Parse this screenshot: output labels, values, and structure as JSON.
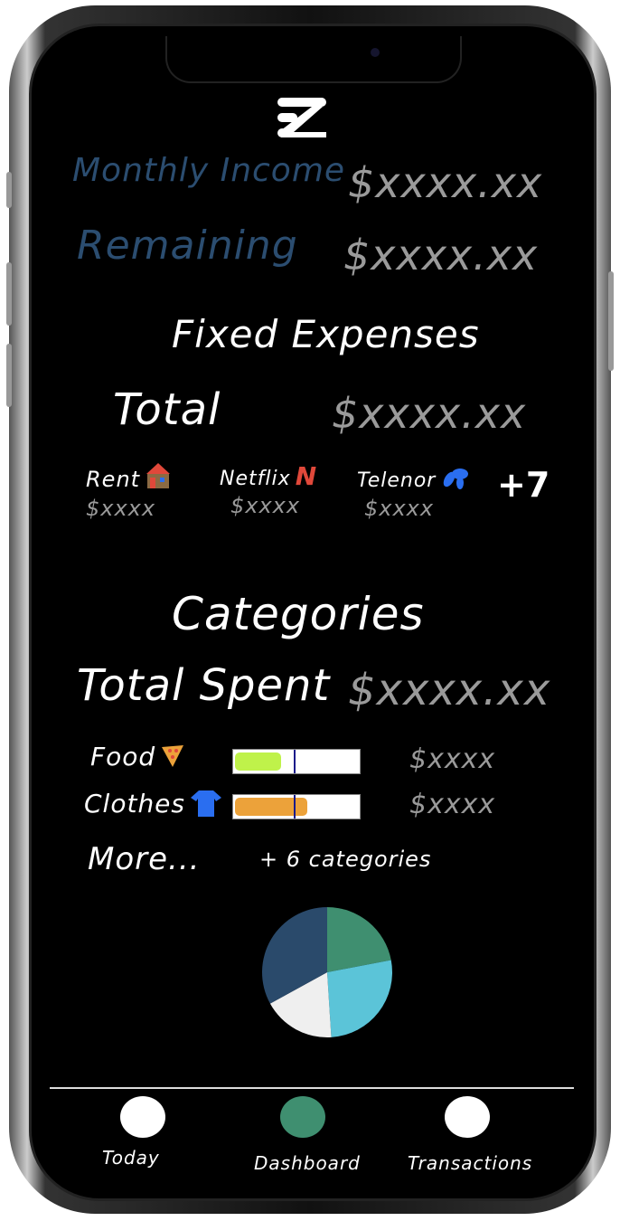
{
  "header": {
    "logo_text": "EZ"
  },
  "summary": {
    "monthly_income_label": "Monthly Income",
    "monthly_income_value": "$xxxx.xx",
    "remaining_label": "Remaining",
    "remaining_value": "$xxxx.xx"
  },
  "fixed_expenses": {
    "title": "Fixed Expenses",
    "total_label": "Total",
    "total_value": "$xxxx.xx",
    "items": [
      {
        "label": "Rent",
        "icon": "house-icon",
        "value": "$xxxx"
      },
      {
        "label": "Netflix",
        "icon": "netflix-icon",
        "value": "$xxxx"
      },
      {
        "label": "Telenor",
        "icon": "telenor-icon",
        "value": "$xxxx"
      }
    ],
    "more_count": "+7"
  },
  "categories": {
    "title": "Categories",
    "total_label": "Total Spent",
    "total_value": "$xxxx.xx",
    "items": [
      {
        "label": "Food",
        "icon": "pizza-icon",
        "value": "$xxxx",
        "progress": 0.37,
        "marker": 0.48,
        "color": "#bff24a"
      },
      {
        "label": "Clothes",
        "icon": "tshirt-icon",
        "value": "$xxxx",
        "progress": 0.58,
        "marker": 0.48,
        "color": "#eca23a"
      }
    ],
    "more_label": "More...",
    "more_text": "+ 6 categories"
  },
  "chart_data": {
    "type": "pie",
    "values": [
      22,
      27,
      18,
      33
    ],
    "colors": [
      "#3f8f70",
      "#5bc4d8",
      "#efefef",
      "#2a4a6b"
    ]
  },
  "nav": [
    {
      "label": "Today",
      "color": "#ffffff"
    },
    {
      "label": "Dashboard",
      "color": "#3f8f70"
    },
    {
      "label": "Transactions",
      "color": "#ffffff"
    }
  ]
}
